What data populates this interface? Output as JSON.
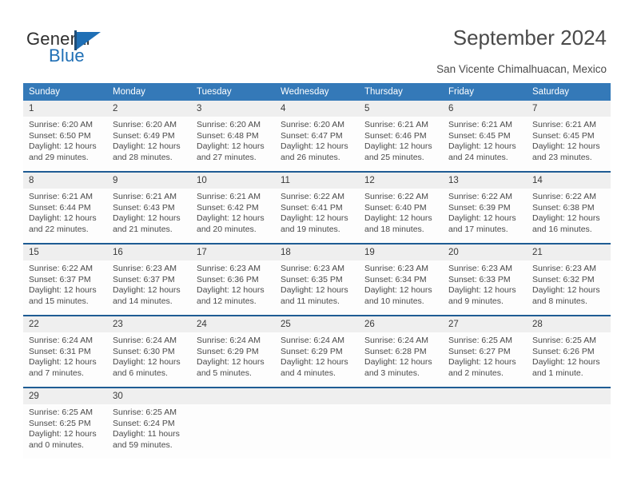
{
  "brand": {
    "name_top": "General",
    "name_bottom": "Blue",
    "flag_icon": "triangle-flag-icon",
    "accent_color": "#1f6fb5"
  },
  "header": {
    "title": "September 2024",
    "subtitle": "San Vicente Chimalhuacan, Mexico"
  },
  "colors": {
    "header_blue": "#3479b8",
    "divider_blue": "#1f5c94",
    "daynum_band": "#efefef"
  },
  "calendar": {
    "weekday_headers": [
      "Sunday",
      "Monday",
      "Tuesday",
      "Wednesday",
      "Thursday",
      "Friday",
      "Saturday"
    ],
    "weeks": [
      [
        {
          "day": "1",
          "sunrise": "Sunrise: 6:20 AM",
          "sunset": "Sunset: 6:50 PM",
          "daylight1": "Daylight: 12 hours",
          "daylight2": "and 29 minutes."
        },
        {
          "day": "2",
          "sunrise": "Sunrise: 6:20 AM",
          "sunset": "Sunset: 6:49 PM",
          "daylight1": "Daylight: 12 hours",
          "daylight2": "and 28 minutes."
        },
        {
          "day": "3",
          "sunrise": "Sunrise: 6:20 AM",
          "sunset": "Sunset: 6:48 PM",
          "daylight1": "Daylight: 12 hours",
          "daylight2": "and 27 minutes."
        },
        {
          "day": "4",
          "sunrise": "Sunrise: 6:20 AM",
          "sunset": "Sunset: 6:47 PM",
          "daylight1": "Daylight: 12 hours",
          "daylight2": "and 26 minutes."
        },
        {
          "day": "5",
          "sunrise": "Sunrise: 6:21 AM",
          "sunset": "Sunset: 6:46 PM",
          "daylight1": "Daylight: 12 hours",
          "daylight2": "and 25 minutes."
        },
        {
          "day": "6",
          "sunrise": "Sunrise: 6:21 AM",
          "sunset": "Sunset: 6:45 PM",
          "daylight1": "Daylight: 12 hours",
          "daylight2": "and 24 minutes."
        },
        {
          "day": "7",
          "sunrise": "Sunrise: 6:21 AM",
          "sunset": "Sunset: 6:45 PM",
          "daylight1": "Daylight: 12 hours",
          "daylight2": "and 23 minutes."
        }
      ],
      [
        {
          "day": "8",
          "sunrise": "Sunrise: 6:21 AM",
          "sunset": "Sunset: 6:44 PM",
          "daylight1": "Daylight: 12 hours",
          "daylight2": "and 22 minutes."
        },
        {
          "day": "9",
          "sunrise": "Sunrise: 6:21 AM",
          "sunset": "Sunset: 6:43 PM",
          "daylight1": "Daylight: 12 hours",
          "daylight2": "and 21 minutes."
        },
        {
          "day": "10",
          "sunrise": "Sunrise: 6:21 AM",
          "sunset": "Sunset: 6:42 PM",
          "daylight1": "Daylight: 12 hours",
          "daylight2": "and 20 minutes."
        },
        {
          "day": "11",
          "sunrise": "Sunrise: 6:22 AM",
          "sunset": "Sunset: 6:41 PM",
          "daylight1": "Daylight: 12 hours",
          "daylight2": "and 19 minutes."
        },
        {
          "day": "12",
          "sunrise": "Sunrise: 6:22 AM",
          "sunset": "Sunset: 6:40 PM",
          "daylight1": "Daylight: 12 hours",
          "daylight2": "and 18 minutes."
        },
        {
          "day": "13",
          "sunrise": "Sunrise: 6:22 AM",
          "sunset": "Sunset: 6:39 PM",
          "daylight1": "Daylight: 12 hours",
          "daylight2": "and 17 minutes."
        },
        {
          "day": "14",
          "sunrise": "Sunrise: 6:22 AM",
          "sunset": "Sunset: 6:38 PM",
          "daylight1": "Daylight: 12 hours",
          "daylight2": "and 16 minutes."
        }
      ],
      [
        {
          "day": "15",
          "sunrise": "Sunrise: 6:22 AM",
          "sunset": "Sunset: 6:37 PM",
          "daylight1": "Daylight: 12 hours",
          "daylight2": "and 15 minutes."
        },
        {
          "day": "16",
          "sunrise": "Sunrise: 6:23 AM",
          "sunset": "Sunset: 6:37 PM",
          "daylight1": "Daylight: 12 hours",
          "daylight2": "and 14 minutes."
        },
        {
          "day": "17",
          "sunrise": "Sunrise: 6:23 AM",
          "sunset": "Sunset: 6:36 PM",
          "daylight1": "Daylight: 12 hours",
          "daylight2": "and 12 minutes."
        },
        {
          "day": "18",
          "sunrise": "Sunrise: 6:23 AM",
          "sunset": "Sunset: 6:35 PM",
          "daylight1": "Daylight: 12 hours",
          "daylight2": "and 11 minutes."
        },
        {
          "day": "19",
          "sunrise": "Sunrise: 6:23 AM",
          "sunset": "Sunset: 6:34 PM",
          "daylight1": "Daylight: 12 hours",
          "daylight2": "and 10 minutes."
        },
        {
          "day": "20",
          "sunrise": "Sunrise: 6:23 AM",
          "sunset": "Sunset: 6:33 PM",
          "daylight1": "Daylight: 12 hours",
          "daylight2": "and 9 minutes."
        },
        {
          "day": "21",
          "sunrise": "Sunrise: 6:23 AM",
          "sunset": "Sunset: 6:32 PM",
          "daylight1": "Daylight: 12 hours",
          "daylight2": "and 8 minutes."
        }
      ],
      [
        {
          "day": "22",
          "sunrise": "Sunrise: 6:24 AM",
          "sunset": "Sunset: 6:31 PM",
          "daylight1": "Daylight: 12 hours",
          "daylight2": "and 7 minutes."
        },
        {
          "day": "23",
          "sunrise": "Sunrise: 6:24 AM",
          "sunset": "Sunset: 6:30 PM",
          "daylight1": "Daylight: 12 hours",
          "daylight2": "and 6 minutes."
        },
        {
          "day": "24",
          "sunrise": "Sunrise: 6:24 AM",
          "sunset": "Sunset: 6:29 PM",
          "daylight1": "Daylight: 12 hours",
          "daylight2": "and 5 minutes."
        },
        {
          "day": "25",
          "sunrise": "Sunrise: 6:24 AM",
          "sunset": "Sunset: 6:29 PM",
          "daylight1": "Daylight: 12 hours",
          "daylight2": "and 4 minutes."
        },
        {
          "day": "26",
          "sunrise": "Sunrise: 6:24 AM",
          "sunset": "Sunset: 6:28 PM",
          "daylight1": "Daylight: 12 hours",
          "daylight2": "and 3 minutes."
        },
        {
          "day": "27",
          "sunrise": "Sunrise: 6:25 AM",
          "sunset": "Sunset: 6:27 PM",
          "daylight1": "Daylight: 12 hours",
          "daylight2": "and 2 minutes."
        },
        {
          "day": "28",
          "sunrise": "Sunrise: 6:25 AM",
          "sunset": "Sunset: 6:26 PM",
          "daylight1": "Daylight: 12 hours",
          "daylight2": "and 1 minute."
        }
      ],
      [
        {
          "day": "29",
          "sunrise": "Sunrise: 6:25 AM",
          "sunset": "Sunset: 6:25 PM",
          "daylight1": "Daylight: 12 hours",
          "daylight2": "and 0 minutes."
        },
        {
          "day": "30",
          "sunrise": "Sunrise: 6:25 AM",
          "sunset": "Sunset: 6:24 PM",
          "daylight1": "Daylight: 11 hours",
          "daylight2": "and 59 minutes."
        },
        {
          "day": "",
          "sunrise": "",
          "sunset": "",
          "daylight1": "",
          "daylight2": ""
        },
        {
          "day": "",
          "sunrise": "",
          "sunset": "",
          "daylight1": "",
          "daylight2": ""
        },
        {
          "day": "",
          "sunrise": "",
          "sunset": "",
          "daylight1": "",
          "daylight2": ""
        },
        {
          "day": "",
          "sunrise": "",
          "sunset": "",
          "daylight1": "",
          "daylight2": ""
        },
        {
          "day": "",
          "sunrise": "",
          "sunset": "",
          "daylight1": "",
          "daylight2": ""
        }
      ]
    ]
  }
}
